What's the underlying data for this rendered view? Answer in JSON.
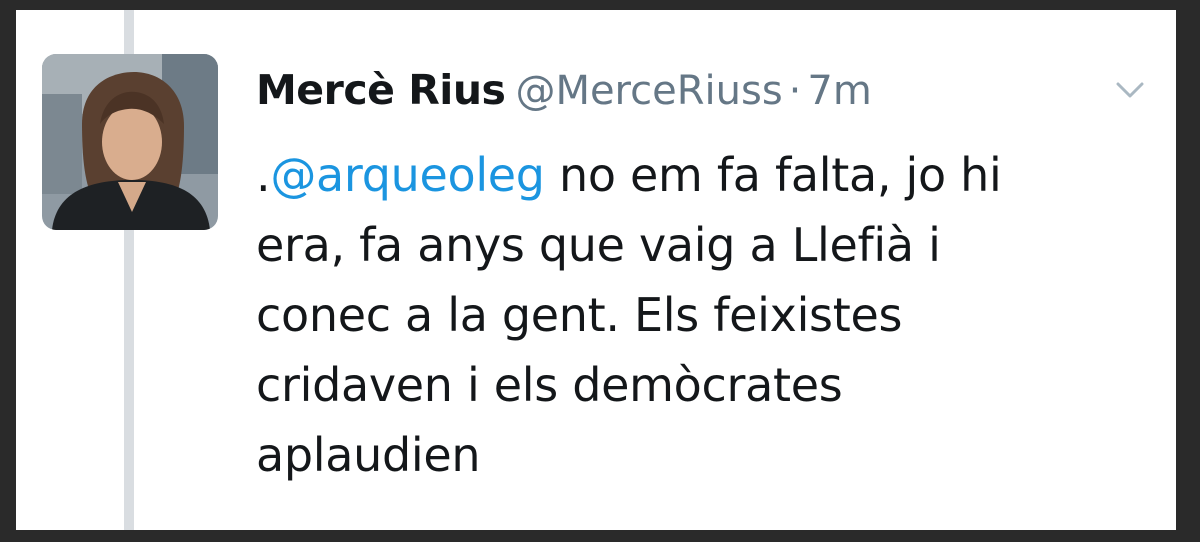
{
  "tweet": {
    "author_name": "Mercè Rius",
    "author_handle": "@MerceRiuss",
    "separator": "·",
    "timestamp": "7m",
    "text_prefix": ".",
    "mention": "@arqueoleg",
    "text_lines": [
      " no em fa falta, jo hi",
      "era, fa anys que vaig a Llefià i",
      "conec a la gent. Els feixistes",
      "cridaven i els demòcrates",
      "aplaudien"
    ]
  },
  "colors": {
    "mention": "#1b95e0",
    "secondary_text": "#657786",
    "primary_text": "#14171a",
    "thread_line": "#d9dde1"
  },
  "icons": {
    "avatar": "profile-photo",
    "menu": "chevron-down-icon"
  }
}
